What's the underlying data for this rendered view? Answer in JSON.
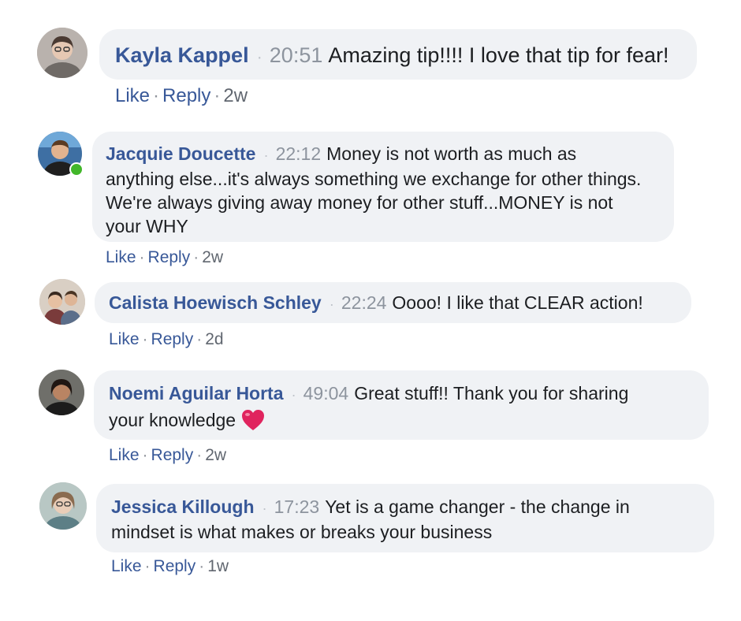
{
  "separator": "·",
  "comments": [
    {
      "author": "Kayla Kappel",
      "timestamp": "20:51",
      "text": "Amazing tip!!!! I love that tip for fear!",
      "like_label": "Like",
      "reply_label": "Reply",
      "age": "2w"
    },
    {
      "author": "Jacquie Doucette",
      "timestamp": "22:12",
      "text_lines": [
        "Money is not worth as much as",
        "anything else...it's always something we exchange for other things.",
        "We're always giving away money for other stuff...MONEY is not",
        "your WHY"
      ],
      "online": true,
      "like_label": "Like",
      "reply_label": "Reply",
      "age": "2w"
    },
    {
      "author": "Calista Hoewisch Schley",
      "timestamp": "22:24",
      "text": "Oooo! I like that CLEAR action!",
      "like_label": "Like",
      "reply_label": "Reply",
      "age": "2d"
    },
    {
      "author": "Noemi Aguilar Horta",
      "timestamp": "49:04",
      "text_lines": [
        "Great stuff!! Thank you for sharing",
        "your knowledge"
      ],
      "emoji": "heart-emoji",
      "like_label": "Like",
      "reply_label": "Reply",
      "age": "2w"
    },
    {
      "author": "Jessica Killough",
      "timestamp": "17:23",
      "text_lines": [
        "Yet is a game changer - the change in",
        "mindset is what makes or breaks your business"
      ],
      "like_label": "Like",
      "reply_label": "Reply",
      "age": "1w"
    }
  ],
  "colors": {
    "name": "#385898",
    "bubble": "#f0f2f5",
    "online": "#42b72a",
    "heart": "#e0245e"
  }
}
